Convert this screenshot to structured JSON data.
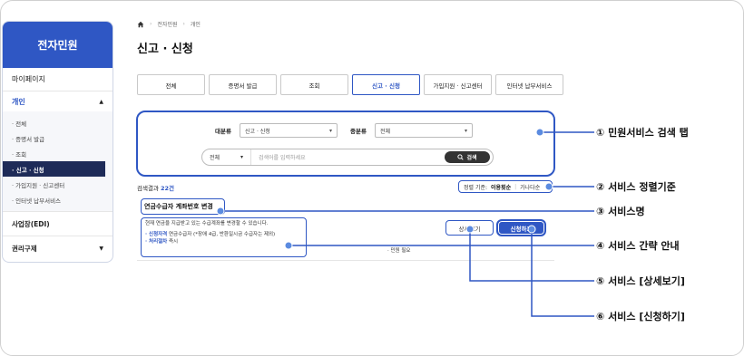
{
  "sidebar": {
    "title": "전자민원",
    "items": [
      {
        "label": "마이페이지"
      },
      {
        "label": "개인",
        "caret": "▲"
      },
      {
        "label": "사업장(EDI)"
      },
      {
        "label": "권리구제",
        "caret": "▼"
      }
    ],
    "sub_items": [
      {
        "label": "· 전체"
      },
      {
        "label": "· 증명서 발급"
      },
      {
        "label": "· 조회"
      },
      {
        "label": "· 신고 · 신청"
      },
      {
        "label": "· 가입지원 · 신고센터"
      },
      {
        "label": "· 인터넷 납부서비스"
      }
    ]
  },
  "breadcrumb": [
    "전자민원",
    "개인"
  ],
  "page_title": "신고 · 신청",
  "tabs": [
    {
      "label": "전체"
    },
    {
      "label": "증명서 발급"
    },
    {
      "label": "조회"
    },
    {
      "label": "신고 · 신청"
    },
    {
      "label": "가입지원 · 신고센터"
    },
    {
      "label": "인터넷 납부서비스"
    }
  ],
  "search": {
    "major_label": "대분류",
    "major_value": "신고 · 신청",
    "minor_label": "중분류",
    "minor_value": "전체",
    "scope_value": "전체",
    "placeholder": "검색어를 입력하세요",
    "button_label": "검색"
  },
  "results": {
    "count_label": "검색결과",
    "count": "22건",
    "sort_label": "정렬 기준:",
    "sort_options": [
      "이용횟순",
      "가나다순"
    ]
  },
  "service": {
    "title": "연금수급자 계좌번호 변경",
    "desc": "현재 연금을 지급받고 있는 수급계좌를 변경할 수 있습니다.",
    "qual_label": "· 신청자격",
    "qual_value": "연금수급자 (*장애 4급, 반환일시금 수급자는 제외)",
    "proc_label": "· 처리절차",
    "proc_value": "즉시",
    "right_text": "· 민원 필요",
    "detail_button": "상세보기",
    "apply_button": "신청하기"
  },
  "callouts": [
    "① 민원서비스 검색 탭",
    "② 서비스 정렬기준",
    "③ 서비스명",
    "④ 서비스 간략 안내",
    "⑤ 서비스 [상세보기]",
    "⑥ 서비스 [신청하기]"
  ],
  "colors": {
    "accent": "#2f57c4",
    "sidebar_active": "#1e2b58"
  }
}
